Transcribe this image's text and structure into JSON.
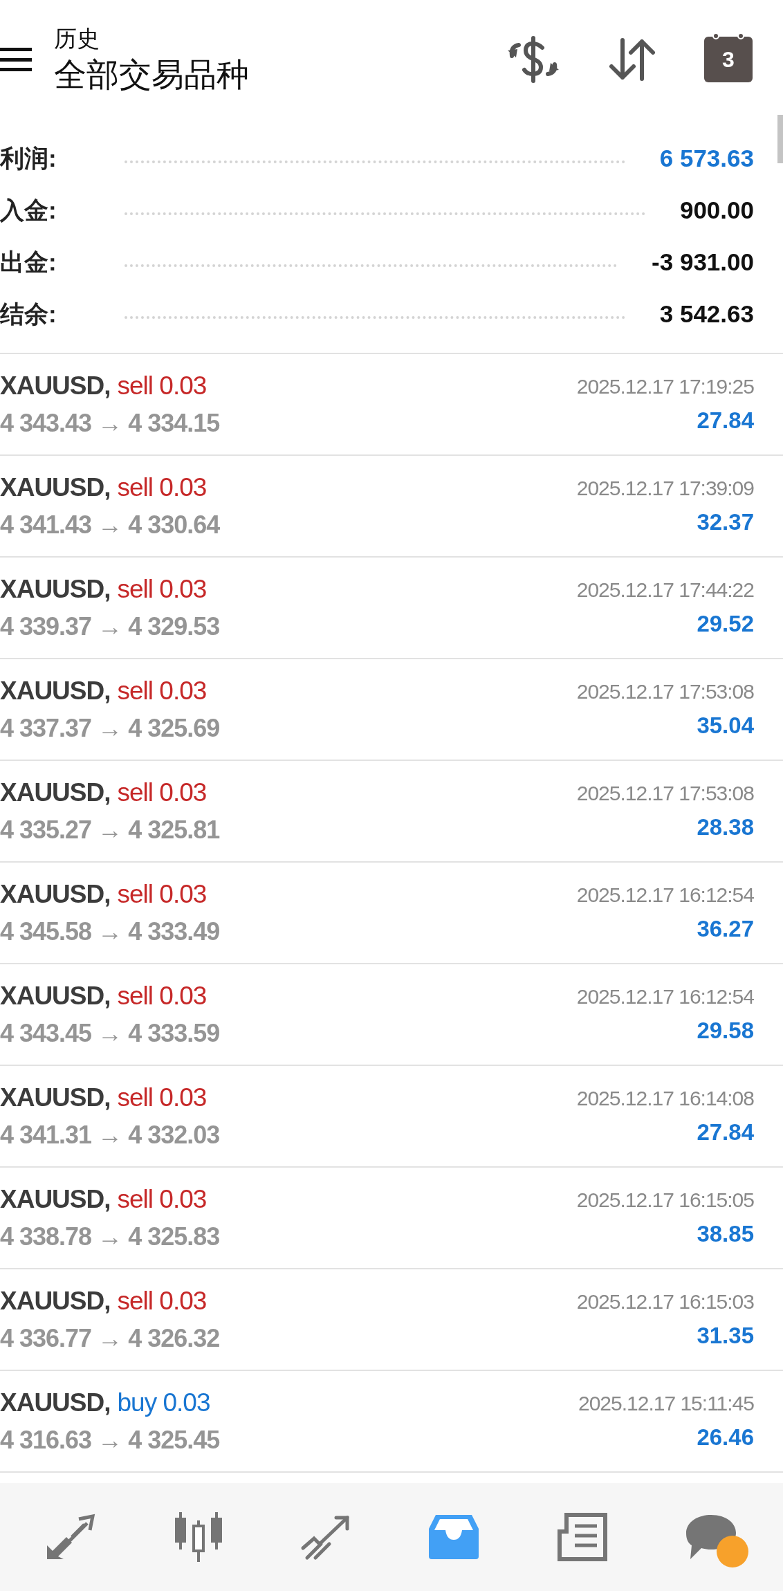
{
  "header": {
    "subtitle": "历史",
    "title": "全部交易品种",
    "calendar_day": "3"
  },
  "summary": [
    {
      "label": "利润:",
      "value": "6 573.63",
      "accent": true
    },
    {
      "label": "入金:",
      "value": "900.00",
      "accent": false
    },
    {
      "label": "出金:",
      "value": "-3 931.00",
      "accent": false
    },
    {
      "label": "结余:",
      "value": "3 542.63",
      "accent": false
    }
  ],
  "deals": [
    {
      "symbol": "XAUUSD,",
      "kind": "sell",
      "volume": "sell 0.03",
      "prices": "4 343.43 → 4 334.15",
      "time": "2025.12.17 17:19:25",
      "profit": "27.84"
    },
    {
      "symbol": "XAUUSD,",
      "kind": "sell",
      "volume": "sell 0.03",
      "prices": "4 341.43 → 4 330.64",
      "time": "2025.12.17 17:39:09",
      "profit": "32.37"
    },
    {
      "symbol": "XAUUSD,",
      "kind": "sell",
      "volume": "sell 0.03",
      "prices": "4 339.37 → 4 329.53",
      "time": "2025.12.17 17:44:22",
      "profit": "29.52"
    },
    {
      "symbol": "XAUUSD,",
      "kind": "sell",
      "volume": "sell 0.03",
      "prices": "4 337.37 → 4 325.69",
      "time": "2025.12.17 17:53:08",
      "profit": "35.04"
    },
    {
      "symbol": "XAUUSD,",
      "kind": "sell",
      "volume": "sell 0.03",
      "prices": "4 335.27 → 4 325.81",
      "time": "2025.12.17 17:53:08",
      "profit": "28.38"
    },
    {
      "symbol": "XAUUSD,",
      "kind": "sell",
      "volume": "sell 0.03",
      "prices": "4 345.58 → 4 333.49",
      "time": "2025.12.17 16:12:54",
      "profit": "36.27"
    },
    {
      "symbol": "XAUUSD,",
      "kind": "sell",
      "volume": "sell 0.03",
      "prices": "4 343.45 → 4 333.59",
      "time": "2025.12.17 16:12:54",
      "profit": "29.58"
    },
    {
      "symbol": "XAUUSD,",
      "kind": "sell",
      "volume": "sell 0.03",
      "prices": "4 341.31 → 4 332.03",
      "time": "2025.12.17 16:14:08",
      "profit": "27.84"
    },
    {
      "symbol": "XAUUSD,",
      "kind": "sell",
      "volume": "sell 0.03",
      "prices": "4 338.78 → 4 325.83",
      "time": "2025.12.17 16:15:05",
      "profit": "38.85"
    },
    {
      "symbol": "XAUUSD,",
      "kind": "sell",
      "volume": "sell 0.03",
      "prices": "4 336.77 → 4 326.32",
      "time": "2025.12.17 16:15:03",
      "profit": "31.35"
    },
    {
      "symbol": "XAUUSD,",
      "kind": "buy",
      "volume": "buy 0.03",
      "prices": "4 316.63 → 4 325.45",
      "time": "2025.12.17 15:11:45",
      "profit": "26.46"
    }
  ],
  "nav": [
    {
      "kind": "trade",
      "selected": false
    },
    {
      "kind": "quotes",
      "selected": false
    },
    {
      "kind": "chart",
      "selected": false
    },
    {
      "kind": "history",
      "selected": true
    },
    {
      "kind": "news",
      "selected": false
    },
    {
      "kind": "chat",
      "selected": false,
      "badge": true
    }
  ]
}
